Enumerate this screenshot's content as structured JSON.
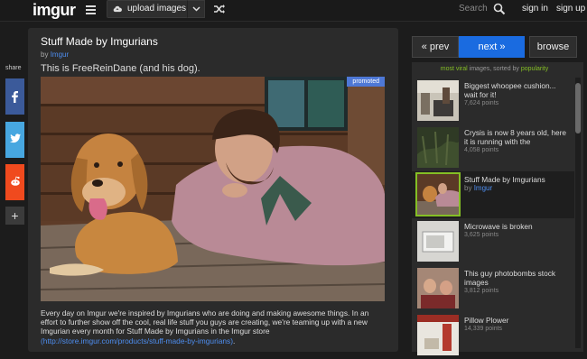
{
  "header": {
    "logo": "imgur",
    "upload_label": "upload images",
    "search_placeholder": "Search",
    "signin": "sign in",
    "signup": "sign up"
  },
  "post": {
    "title": "Stuff Made by Imgurians",
    "by_prefix": "by",
    "author": "Imgur",
    "description": "This is FreeReinDane (and his dog).",
    "badge": "promoted",
    "caption": "Every day on Imgur we're inspired by Imgurians who are doing and making awesome things. In an effort to further show off the cool, real life stuff you guys are creating, we're teaming up with a new Imgurian every month for Stuff Made by Imgurians in the Imgur store",
    "caption_link": "(http://store.imgur.com/products/stuff-made-by-imgurians)",
    "caption_end": "."
  },
  "share": {
    "label": "share",
    "plus": "+"
  },
  "nav": {
    "prev": "« prev",
    "next": "next »",
    "browse": "browse"
  },
  "sidebar": {
    "head_green": "most viral",
    "head_mid": "images, sorted by",
    "head_sort": "popularity",
    "items": [
      {
        "title": "Biggest whoopee cushion... wait for it!",
        "points": "7,624 points"
      },
      {
        "title": "Crysis is now 8 years old, here it is running with the",
        "points": "4,058 points"
      },
      {
        "title": "Stuff Made by Imgurians",
        "by_prefix": "by",
        "author": "Imgur"
      },
      {
        "title": "Microwave is broken",
        "points": "3,625 points"
      },
      {
        "title": "This guy photobombs stock images",
        "points": "3,812 points"
      },
      {
        "title": "Pillow Plower",
        "points": "14,339 points"
      }
    ]
  },
  "colors": {
    "accent_blue": "#1a6be0",
    "viral_green": "#85bf25",
    "facebook": "#3b5a9a",
    "twitter": "#47a7e0",
    "reddit": "#f04a1e"
  },
  "icons": [
    "menu-icon",
    "cloud-upload-icon",
    "chevron-down-icon",
    "shuffle-icon",
    "search-icon",
    "facebook-icon",
    "twitter-icon",
    "reddit-icon",
    "plus-icon"
  ]
}
